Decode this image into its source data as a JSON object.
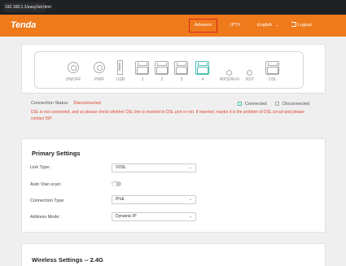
{
  "browser": {
    "url": "192.168.1.1/easySet.html"
  },
  "header": {
    "logo": "Tenda",
    "nav": {
      "advance": "Advance",
      "iptv": "IPTV",
      "language": "English",
      "logout": "Logout"
    }
  },
  "device": {
    "ports": [
      {
        "label": "ON/OFF"
      },
      {
        "label": "PWR"
      },
      {
        "label": "USB"
      },
      {
        "label": "1"
      },
      {
        "label": "2"
      },
      {
        "label": "3"
      },
      {
        "label": "4"
      },
      {
        "label": "WPS/Wi-Fi"
      },
      {
        "label": "RST"
      },
      {
        "label": "DSL"
      }
    ],
    "connected_color": "#4bc0b4",
    "disconnected_color": "#aaaaaa"
  },
  "connection": {
    "status_label": "Connection Status:",
    "status_value": "Disconnected",
    "legend_connected": "Connected",
    "legend_disconnected": "Disconnected",
    "warning": "DSL is not connected, and so please check whether DSL line is inserted to DSL port or not. If inserted, maybe it is the problem of DSL circuit and please contact ISP."
  },
  "primary": {
    "title": "Primary Settings",
    "link_type": {
      "label": "Link Type:",
      "value": "VDSL"
    },
    "vlan_scan": {
      "label": "Auto Vlan scan:"
    },
    "connection_type": {
      "label": "Connection Type:",
      "value": "IPoE"
    },
    "address_mode": {
      "label": "Address Mode:",
      "value": "Dynamic IP"
    }
  },
  "wireless": {
    "title": "Wireless Settings -- 2.4G"
  },
  "colors": {
    "brand": "#ee7a1c",
    "alert": "#e0452f",
    "highlight_border": "#d9261c"
  }
}
